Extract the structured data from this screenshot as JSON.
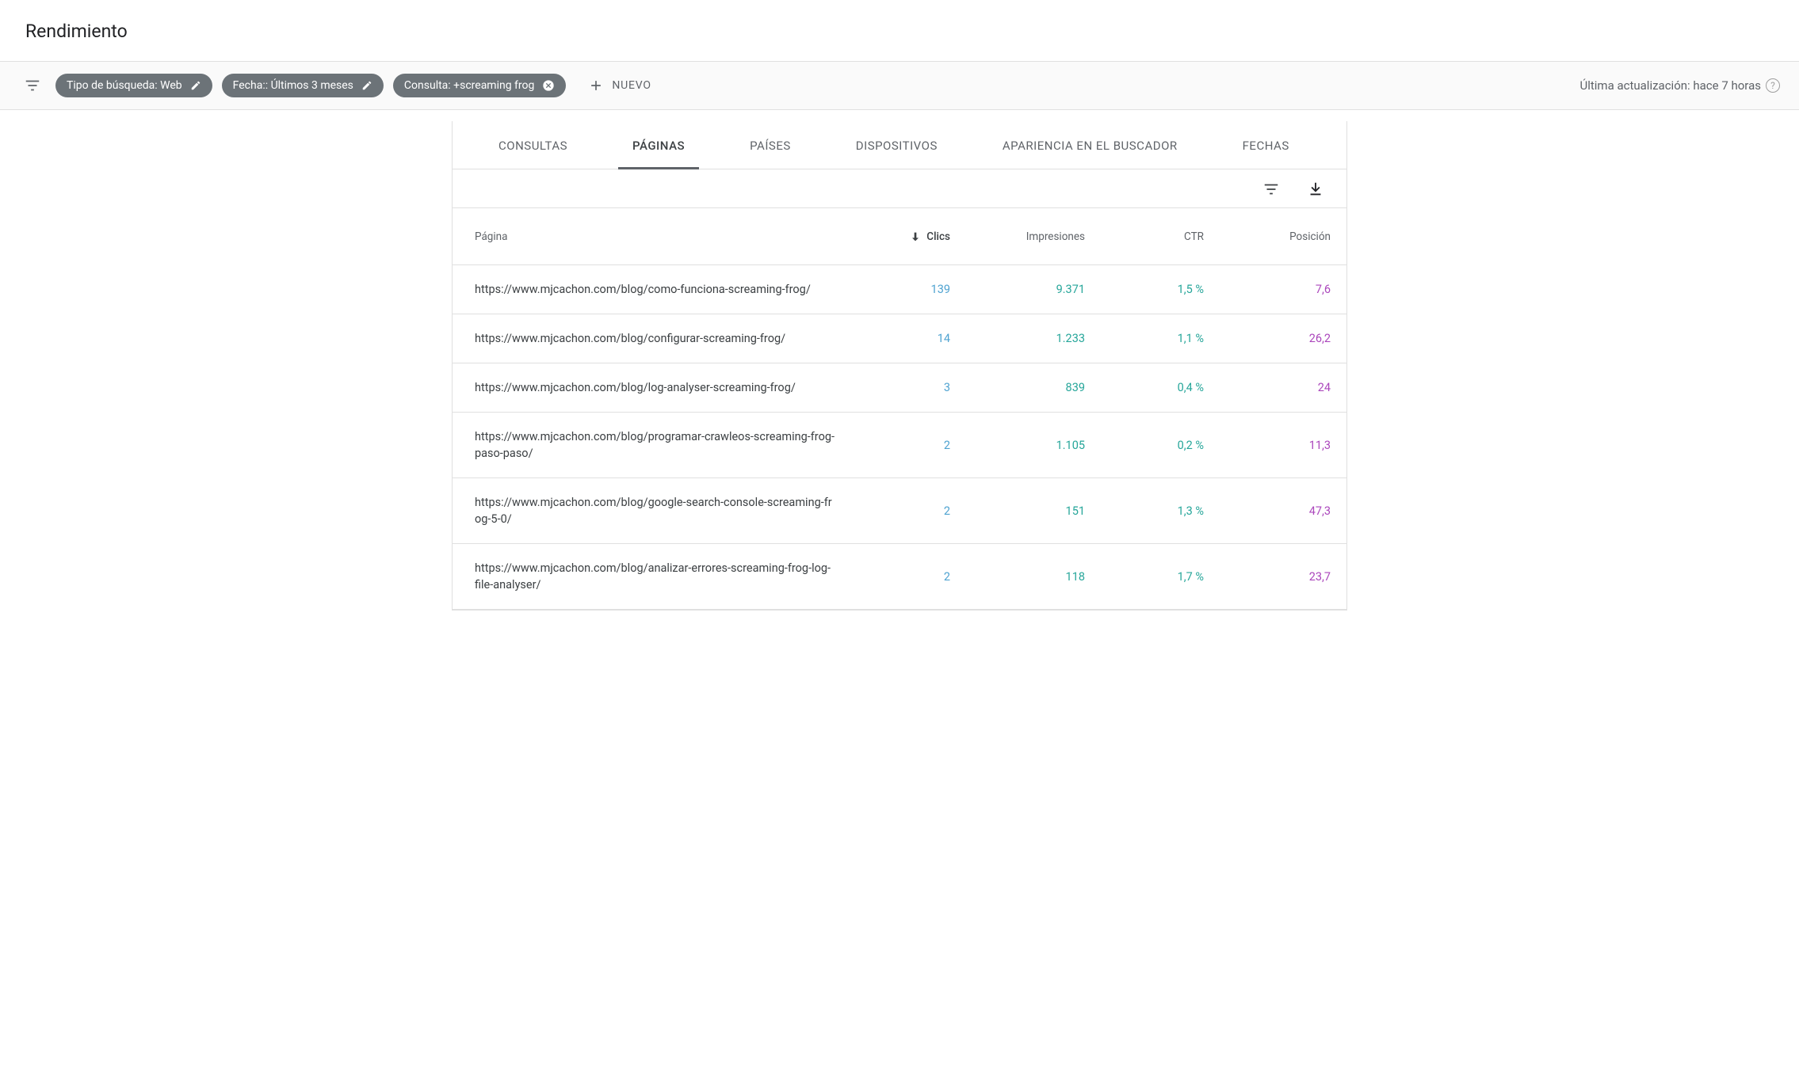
{
  "header": {
    "title": "Rendimiento"
  },
  "filters": {
    "chip_search_type": "Tipo de búsqueda: Web",
    "chip_date": "Fecha:: Últimos 3 meses",
    "chip_query": "Consulta: +screaming frog",
    "new_label": "NUEVO",
    "last_update": "Última actualización: hace 7 horas"
  },
  "tabs": {
    "consultas": "CONSULTAS",
    "paginas": "PÁGINAS",
    "paises": "PAÍSES",
    "dispositivos": "DISPOSITIVOS",
    "apariencia": "APARIENCIA EN EL BUSCADOR",
    "fechas": "FECHAS",
    "active": "paginas"
  },
  "table": {
    "columns": {
      "page": "Página",
      "clicks": "Clics",
      "impressions": "Impresiones",
      "ctr": "CTR",
      "position": "Posición"
    },
    "rows": [
      {
        "page": "https://www.mjcachon.com/blog/como-funciona-screaming-frog/",
        "clicks": "139",
        "impressions": "9.371",
        "ctr": "1,5 %",
        "position": "7,6"
      },
      {
        "page": "https://www.mjcachon.com/blog/configurar-screaming-frog/",
        "clicks": "14",
        "impressions": "1.233",
        "ctr": "1,1 %",
        "position": "26,2"
      },
      {
        "page": "https://www.mjcachon.com/blog/log-analyser-screaming-frog/",
        "clicks": "3",
        "impressions": "839",
        "ctr": "0,4 %",
        "position": "24"
      },
      {
        "page": "https://www.mjcachon.com/blog/programar-crawleos-screaming-frog-paso-paso/",
        "clicks": "2",
        "impressions": "1.105",
        "ctr": "0,2 %",
        "position": "11,3"
      },
      {
        "page": "https://www.mjcachon.com/blog/google-search-console-screaming-frog-5-0/",
        "clicks": "2",
        "impressions": "151",
        "ctr": "1,3 %",
        "position": "47,3"
      },
      {
        "page": "https://www.mjcachon.com/blog/analizar-errores-screaming-frog-log-file-analyser/",
        "clicks": "2",
        "impressions": "118",
        "ctr": "1,7 %",
        "position": "23,7"
      }
    ]
  }
}
